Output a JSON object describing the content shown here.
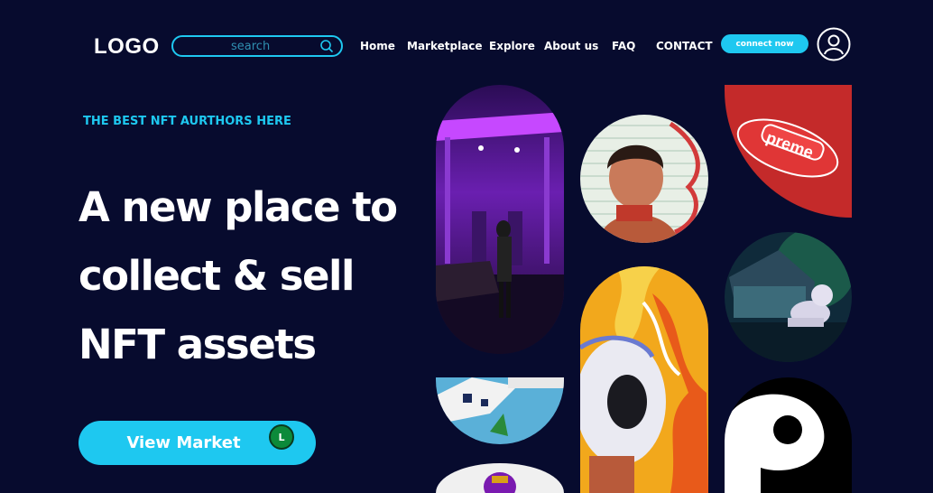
{
  "header": {
    "logo": "LOGO",
    "search_placeholder": "search",
    "nav": [
      "Home",
      "Marketplace",
      "Explore",
      "About us",
      "FAQ",
      "CONTACT"
    ],
    "connect_label": "connect now"
  },
  "hero": {
    "tagline": "THE BEST NFT AURTHORS HERE",
    "headline_lines": [
      "A new place to",
      "collect & sell",
      "NFT assets"
    ],
    "cta_label": "View Market",
    "badge_letter": "L"
  },
  "gallery": {
    "card_text": "preme"
  },
  "colors": {
    "background": "#070b2e",
    "accent": "#1ec8f0"
  }
}
